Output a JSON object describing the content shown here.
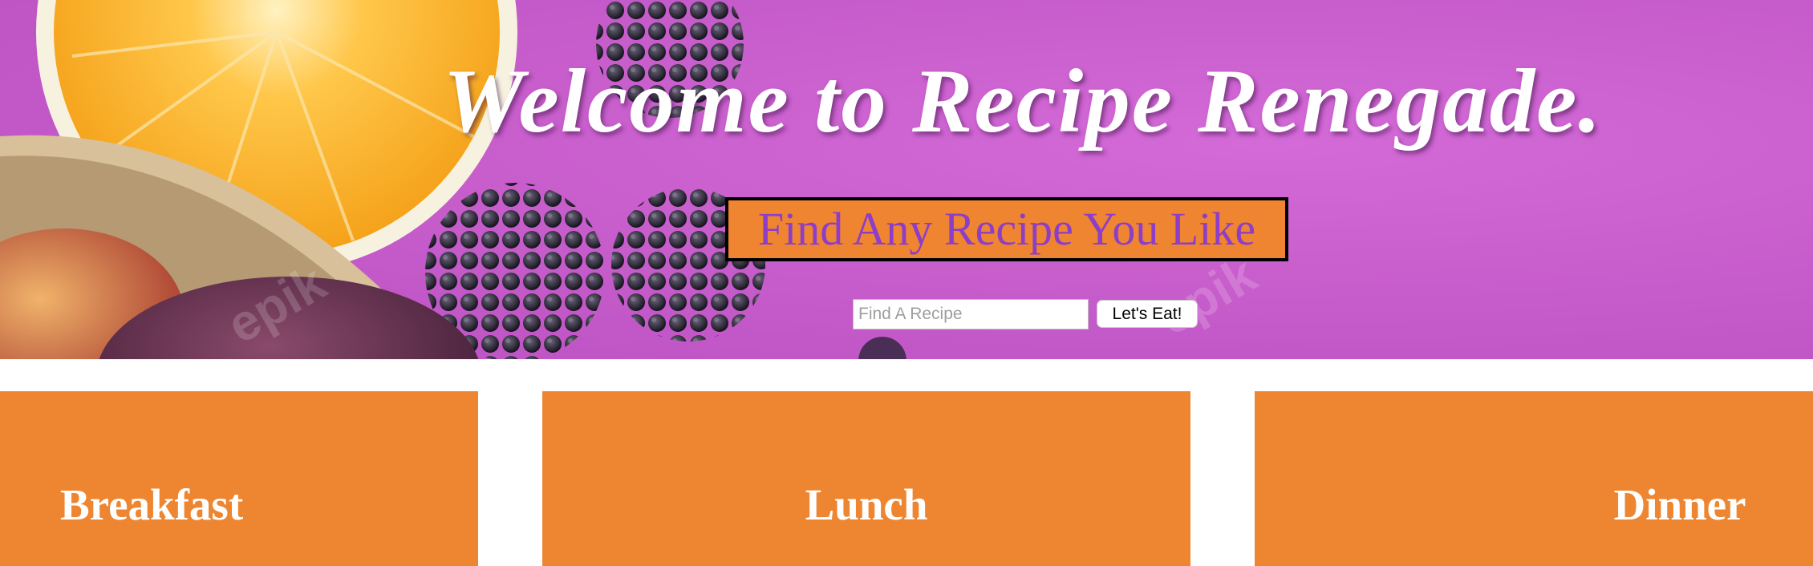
{
  "hero": {
    "title": "Welcome to Recipe Renegade.",
    "tagline": "Find Any Recipe You Like",
    "search": {
      "placeholder": "Find A Recipe",
      "value": "",
      "button_label": "Let's Eat!"
    }
  },
  "meals": [
    {
      "label": "Breakfast"
    },
    {
      "label": "Lunch"
    },
    {
      "label": "Dinner"
    }
  ],
  "colors": {
    "hero_background": "#c85dcc",
    "tagline_background": "#ef8431",
    "tagline_text": "#8d3ec8",
    "card_background": "#ee8631",
    "card_text": "#ffffff"
  }
}
